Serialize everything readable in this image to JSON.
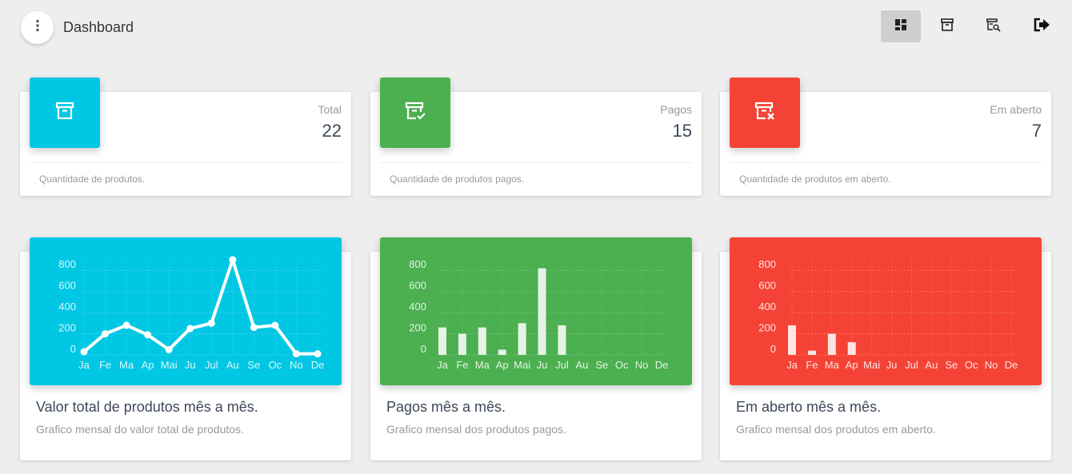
{
  "header": {
    "title": "Dashboard",
    "menu_icon": "more-vert-icon",
    "nav": [
      {
        "icon": "dashboard-icon",
        "active": true
      },
      {
        "icon": "archive-icon",
        "active": false
      },
      {
        "icon": "search-list-icon",
        "active": false
      },
      {
        "icon": "logout-icon",
        "active": false
      }
    ]
  },
  "stats": [
    {
      "category": "Total",
      "value": "22",
      "footer": "Quantidade de produtos.",
      "color": "#00c7e3",
      "icon": "archive-icon"
    },
    {
      "category": "Pagos",
      "value": "15",
      "footer": "Quantidade de produtos pagos.",
      "color": "#4caf50",
      "icon": "archive-check-icon"
    },
    {
      "category": "Em aberto",
      "value": "7",
      "footer": "Quantidade de produtos em aberto.",
      "color": "#f44336",
      "icon": "archive-x-icon"
    }
  ],
  "charts": [
    {
      "title": "Valor total de produtos mês a mês.",
      "subtitle": "Grafico mensal do valor total de produtos.",
      "color": "#00c7e3"
    },
    {
      "title": "Pagos mês a mês.",
      "subtitle": "Grafico mensal dos produtos pagos.",
      "color": "#4caf50"
    },
    {
      "title": "Em aberto mês a mês.",
      "subtitle": "Grafico mensal dos produtos em aberto.",
      "color": "#f44336"
    }
  ],
  "chart_data": [
    {
      "type": "line",
      "categories": [
        "Ja",
        "Fe",
        "Ma",
        "Ap",
        "Mai",
        "Ju",
        "Jul",
        "Au",
        "Se",
        "Oc",
        "No",
        "De"
      ],
      "values": [
        30,
        200,
        280,
        190,
        50,
        250,
        300,
        900,
        260,
        280,
        10,
        10
      ],
      "yticks": [
        "800",
        "600",
        "400",
        "200",
        "0"
      ],
      "ylim": [
        0,
        900
      ],
      "grid": true
    },
    {
      "type": "bar",
      "categories": [
        "Ja",
        "Fe",
        "Ma",
        "Ap",
        "Mai",
        "Ju",
        "Jul",
        "Au",
        "Se",
        "Oc",
        "No",
        "De"
      ],
      "values": [
        260,
        200,
        260,
        50,
        300,
        820,
        280,
        0,
        0,
        0,
        0,
        0
      ],
      "yticks": [
        "800",
        "600",
        "400",
        "200",
        "0"
      ],
      "ylim": [
        0,
        900
      ],
      "grid": true
    },
    {
      "type": "bar",
      "categories": [
        "Ja",
        "Fe",
        "Ma",
        "Ap",
        "Mai",
        "Ju",
        "Jul",
        "Au",
        "Se",
        "Oc",
        "No",
        "De"
      ],
      "values": [
        280,
        40,
        200,
        120,
        0,
        0,
        0,
        0,
        0,
        0,
        0,
        0
      ],
      "yticks": [
        "800",
        "600",
        "400",
        "200",
        "0"
      ],
      "ylim": [
        0,
        900
      ],
      "grid": true
    }
  ]
}
